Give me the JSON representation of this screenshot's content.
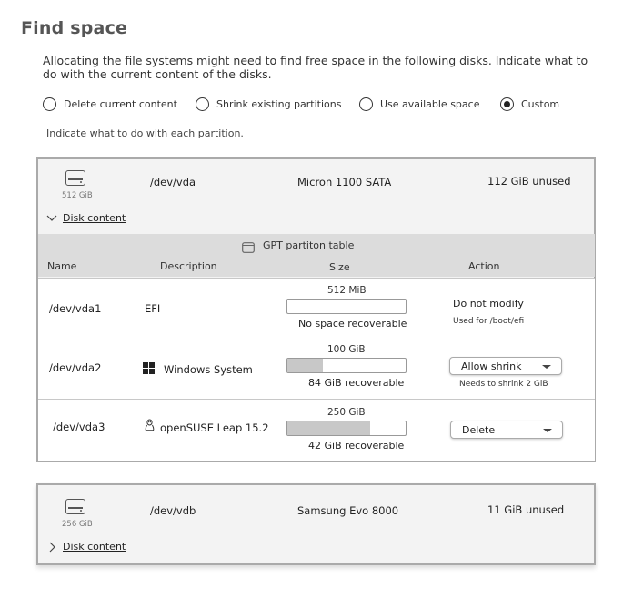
{
  "title": "Find space",
  "intro": "Allocating the file systems might need to find free space in the following disks. Indicate what to do with the current content of the disks.",
  "options": [
    {
      "label": "Delete current content",
      "selected": false
    },
    {
      "label": "Shrink existing partitions",
      "selected": false
    },
    {
      "label": "Use available space",
      "selected": false
    },
    {
      "label": "Custom",
      "selected": true
    }
  ],
  "hint": "Indicate what to do with each partition.",
  "disks": [
    {
      "size": "512 GiB",
      "device": "/dev/vda",
      "model": "Micron 1100 SATA",
      "unused": "112 GiB unused",
      "content_link": "Disk content",
      "expanded": true,
      "partition_table": "GPT partiton table",
      "columns": {
        "name": "Name",
        "description": "Description",
        "size": "Size",
        "action": "Action"
      },
      "partitions": [
        {
          "name": "/dev/vda1",
          "description": "EFI",
          "icon": "",
          "size": "512 MiB",
          "used_fraction": 0.0,
          "recoverable": "No space recoverable",
          "action": "Do not modify",
          "action_note": "Used for /boot/efi"
        },
        {
          "name": "/dev/vda2",
          "description": "Windows System",
          "icon": "windows-icon",
          "size": "100 GiB",
          "used_fraction": 0.3,
          "recoverable": "84 GiB recoverable",
          "action": "Allow shrink",
          "action_note": "Needs to shrink 2 GiB"
        },
        {
          "name": "/dev/vda3",
          "description": "openSUSE Leap 15.2",
          "icon": "linux-icon",
          "size": "250 GiB",
          "used_fraction": 0.7,
          "recoverable": "42 GiB recoverable",
          "action": "Delete",
          "action_note": ""
        }
      ]
    },
    {
      "size": "256 GiB",
      "device": "/dev/vdb",
      "model": "Samsung Evo 8000",
      "unused": "11 GiB unused",
      "content_link": "Disk content",
      "expanded": false
    }
  ]
}
